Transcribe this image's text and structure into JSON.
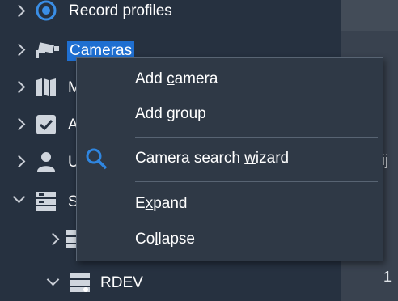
{
  "tree": {
    "items": [
      {
        "label": "Record profiles",
        "icon": "record-profiles-icon",
        "expander": "collapsed"
      },
      {
        "label": "Cameras",
        "icon": "camera-icon",
        "expander": "collapsed",
        "selected": true
      },
      {
        "label": "M",
        "icon": "map-icon",
        "expander": "collapsed"
      },
      {
        "label": "A",
        "icon": "checkbox-icon",
        "expander": "collapsed"
      },
      {
        "label": "U",
        "icon": "user-icon",
        "expander": "collapsed"
      },
      {
        "label": "S",
        "icon": "server-icon",
        "expander": "expanded"
      },
      {
        "label": "",
        "icon": "server-icon",
        "expander": "collapsed"
      },
      {
        "label": "RDEV",
        "icon": "server-icon",
        "expander": "expanded"
      }
    ]
  },
  "right_pane": {
    "partial_char": "ij",
    "number": "1"
  },
  "context_menu": {
    "items": [
      {
        "pre": "Add ",
        "key": "c",
        "post": "amera"
      },
      {
        "pre": "Add ",
        "key": "g",
        "post": "roup"
      },
      {
        "pre": "Camera search ",
        "key": "w",
        "post": "izard",
        "icon": "search-icon"
      },
      {
        "pre": "E",
        "key": "x",
        "post": "pand"
      },
      {
        "pre": "Co",
        "key": "l",
        "post": "lapse"
      }
    ]
  },
  "colors": {
    "accent": "#1f6fd1",
    "panel": "#263140",
    "menu": "#2f3946",
    "icon_blue": "#2f86e0"
  }
}
